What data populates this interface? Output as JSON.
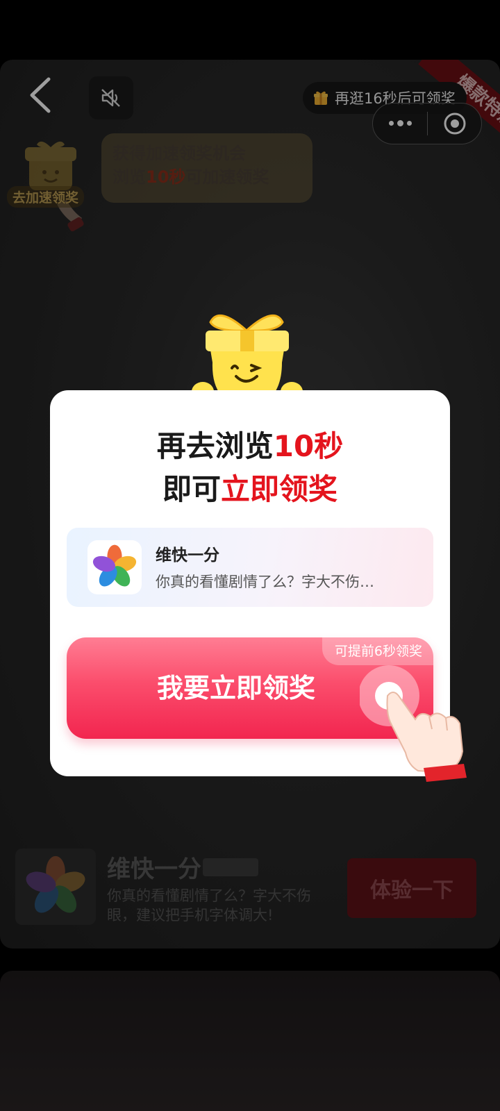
{
  "ad": {
    "countdown_text": "再逛16秒后可领奖",
    "ribbon_text": "爆款特惠",
    "speed_mascot_label": "去加速领奖",
    "speed_bubble": {
      "line1": "获得加速领奖机会",
      "line2_prefix": "浏览",
      "line2_highlight": "10秒",
      "line2_suffix": "可加速领奖"
    },
    "bottom_app": {
      "name": "维快一分",
      "description": "你真的看懂剧情了么？字大不伤眼，建议把手机字体调大!",
      "cta_label": "体验一下"
    }
  },
  "modal": {
    "title_line1_prefix": "再去浏览",
    "title_line1_highlight": "10秒",
    "title_line2_prefix": "即可",
    "title_line2_highlight": "立即领奖",
    "app_name": "维快一分",
    "app_desc": "你真的看懂剧情了么？字大不伤…",
    "claim_button_label": "我要立即领奖",
    "early_tag": "可提前6秒领奖"
  },
  "colors": {
    "accent_red": "#e4141d",
    "button_pink": "#f2254f"
  },
  "icons": [
    "back-arrow-icon",
    "mute-icon",
    "gift-icon",
    "more-icon",
    "close-target-icon",
    "pinwheel-icon",
    "gift-mascot-icon",
    "pointing-hand-icon"
  ]
}
